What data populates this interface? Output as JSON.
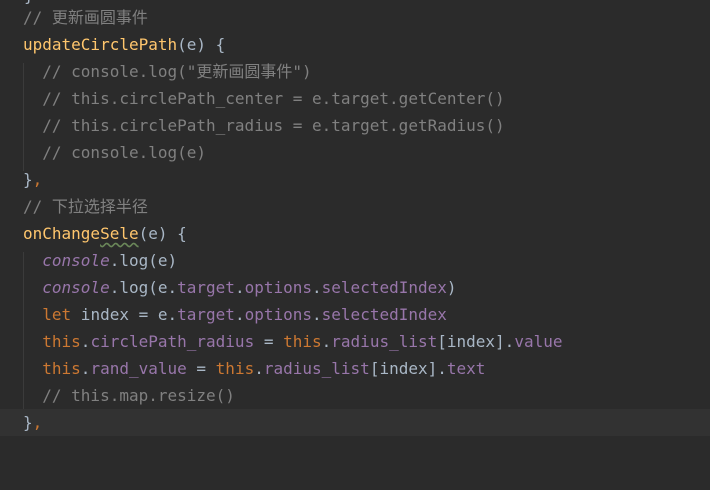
{
  "colors": {
    "background": "#2b2b2b",
    "current_line": "#323232",
    "comment": "#808080",
    "function": "#ffc66d",
    "keyword": "#cc7832",
    "property": "#9876aa",
    "string": "#6a8759",
    "text": "#a9b7c6"
  },
  "code": {
    "top_fragment": "}",
    "l1": {
      "comment": "// 更新画圆事件"
    },
    "l2": {
      "fn": "updateCirclePath",
      "rest": "(e) {"
    },
    "l3": {
      "indent": "  ",
      "comment": "// console.log(\"更新画圆事件\")"
    },
    "l4": {
      "indent": "  ",
      "comment": "// this.circlePath_center = e.target.getCenter()"
    },
    "l5": {
      "indent": "  ",
      "comment": "// this.circlePath_radius = e.target.getRadius()"
    },
    "l6": {
      "indent": "  ",
      "comment": "// console.log(e)"
    },
    "l7": {
      "brace": "}",
      "comma": ","
    },
    "l8": {
      "comment": "// 下拉选择半径"
    },
    "l9": {
      "fn_a": "onChange",
      "fn_b": "Sele",
      "rest": "(e) {"
    },
    "l10": {
      "indent": "  ",
      "obj": "console",
      "dot": ".log(e)"
    },
    "l11": {
      "indent": "  ",
      "obj": "console",
      "p1": ".log(e.",
      "p2": "target",
      "p3": ".",
      "p4": "options",
      "p5": ".",
      "p6": "selectedIndex",
      "p7": ")"
    },
    "l12": {
      "indent": "  ",
      "kw": "let",
      "p1": " index = e.",
      "p2": "target",
      "p3": ".",
      "p4": "options",
      "p5": ".",
      "p6": "selectedIndex"
    },
    "l13": {
      "indent": "  ",
      "kw": "this",
      "p1": ".",
      "p2": "circlePath_radius",
      "p3": " = ",
      "kw2": "this",
      "p4": ".",
      "p5": "radius_list",
      "p6": "[index].",
      "p7": "value"
    },
    "l14": {
      "indent": "  ",
      "kw": "this",
      "p1": ".",
      "p2": "rand_value",
      "p3": " = ",
      "kw2": "this",
      "p4": ".",
      "p5": "radius_list",
      "p6": "[index].",
      "p7": "text"
    },
    "l15": {
      "indent": "  ",
      "comment": "// this.map.resize()"
    },
    "l16": {
      "brace": "}",
      "comma": ","
    }
  }
}
